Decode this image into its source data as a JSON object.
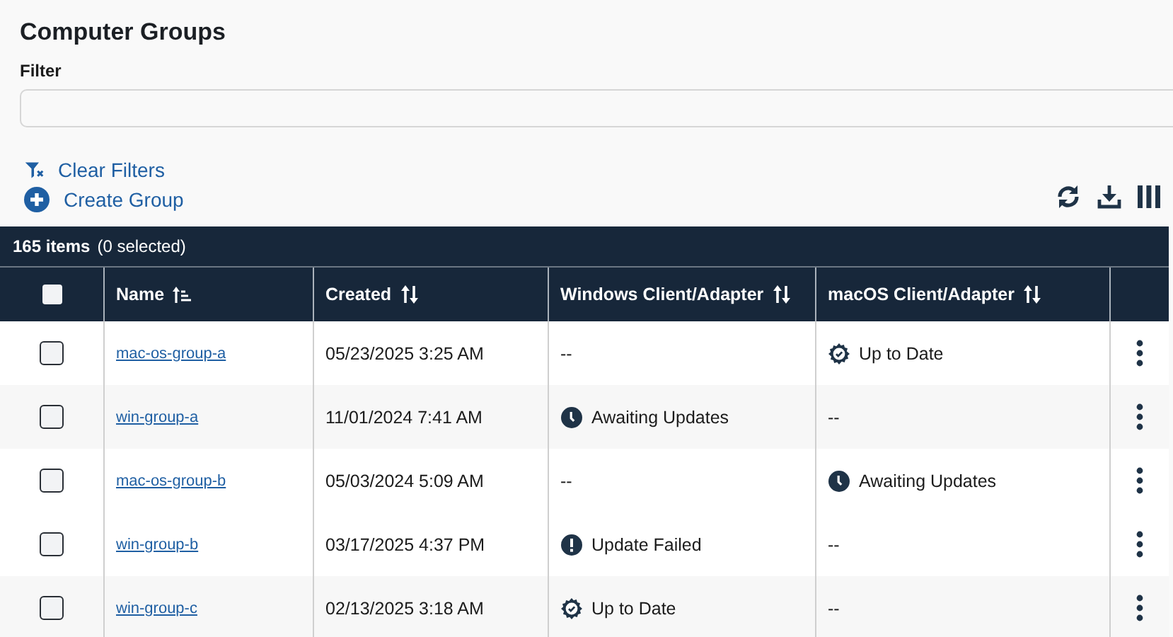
{
  "title": "Computer Groups",
  "filter": {
    "label": "Filter"
  },
  "actions": [
    {
      "kind": "clear",
      "label": "Clear Filters"
    },
    {
      "kind": "create",
      "label": "Create Group"
    }
  ],
  "summary": {
    "count": "165 items",
    "selected": "(0 selected)"
  },
  "select_all": {
    "checked": false
  },
  "columns": [
    {
      "label": "Name",
      "sorted": true
    },
    {
      "label": "Created",
      "sorted": false
    },
    {
      "label": "Windows Client/Adapter",
      "sorted": false
    },
    {
      "label": "macOS Client/Adapter",
      "sorted": false
    }
  ],
  "rows": [
    {
      "checked": false,
      "name": "mac-os-group-a",
      "created": "05/23/2025 3:25 AM",
      "windows": {
        "kind": "none",
        "text": "--"
      },
      "macos": {
        "kind": "ok",
        "text": "Up to Date"
      }
    },
    {
      "checked": false,
      "name": "win-group-a",
      "created": "11/01/2024 7:41 AM",
      "windows": {
        "kind": "waiting",
        "text": "Awaiting Updates"
      },
      "macos": {
        "kind": "none",
        "text": "--"
      }
    },
    {
      "checked": false,
      "name": "mac-os-group-b",
      "created": "05/03/2024 5:09 AM",
      "windows": {
        "kind": "none",
        "text": "--"
      },
      "macos": {
        "kind": "waiting",
        "text": "Awaiting Updates"
      }
    },
    {
      "checked": false,
      "name": "win-group-b",
      "created": "03/17/2025 4:37 PM",
      "windows": {
        "kind": "failed",
        "text": "Update Failed"
      },
      "macos": {
        "kind": "none",
        "text": "--"
      }
    },
    {
      "checked": false,
      "name": "win-group-c",
      "created": "02/13/2025 3:18 AM",
      "windows": {
        "kind": "ok",
        "text": "Up to Date"
      },
      "macos": {
        "kind": "none",
        "text": "--"
      }
    }
  ]
}
